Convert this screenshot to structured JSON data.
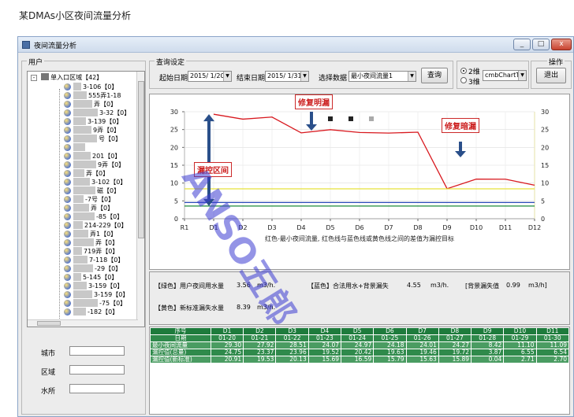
{
  "page_caption": "某DMAs小区夜间流量分析",
  "window": {
    "title": "夜间流量分析",
    "minimize": "_",
    "maximize": "□",
    "close": "x"
  },
  "left_panel": {
    "group_title": "用户",
    "tree_root": "单入口区域【42】",
    "tree_items": [
      "3-106【0】",
      "555弄1-18",
      "弄【0】",
      "3-32【0】",
      "3-139【0】",
      "9弄【0】",
      "号【0】",
      "",
      "201【0】",
      "9弄【0】",
      "弄【0】",
      "3-102【0】",
      "磁【0】",
      "-7号【0】",
      "弄【0】",
      "-85【0】",
      "214-229【0】",
      "弄1【0】",
      "弄【0】",
      "719弄【0】",
      "7-118【0】",
      "-29【0】",
      "5-145【0】",
      "3-159【0】",
      "3-159【0】",
      "-75【0】",
      "-182【0】"
    ],
    "city_label": "城市",
    "district_label": "区域",
    "water_label": "水所"
  },
  "query": {
    "group_title": "查询设定",
    "start_label": "起始日期",
    "start_value": "2015/ 1/20",
    "end_label": "结束日期",
    "end_value": "2015/ 1/31",
    "data_label": "选择数据",
    "data_value": "最小夜间流量1",
    "query_button": "查询",
    "radio_2d": "2维",
    "radio_3d": "3维",
    "chart_type_value": "cmbChartTy",
    "ops_title": "操作",
    "exit_button": "退出"
  },
  "annotations": {
    "fix_visible": "修复明漏",
    "fix_hidden": "修复暗漏",
    "leak_range": "漏控区间"
  },
  "watermark": "ANSO五郎",
  "chart_data": {
    "type": "line",
    "categories": [
      "R1",
      "D1",
      "D2",
      "D3",
      "D4",
      "D5",
      "D6",
      "D7",
      "D8",
      "D9",
      "D10",
      "D11",
      "D12"
    ],
    "ylim": [
      0,
      30
    ],
    "yticks": [
      0,
      5,
      10,
      15,
      20,
      25,
      30
    ],
    "caption": "红色-最小夜间流量, 红色线与蓝色线或黄色线之间的差值为漏控目标",
    "series": [
      {
        "color": "#d8181e",
        "values": [
          null,
          29.3,
          27.92,
          28.51,
          24.07,
          24.97,
          24.18,
          24.01,
          24.27,
          8.42,
          11.1,
          11.09,
          9.4
        ]
      },
      {
        "color": "#1b8a3a",
        "values": [
          3.56,
          3.56,
          3.56,
          3.56,
          3.56,
          3.56,
          3.56,
          3.56,
          3.56,
          3.56,
          3.56,
          3.56,
          3.56
        ]
      },
      {
        "color": "#2a49b8",
        "values": [
          4.55,
          4.55,
          4.55,
          4.55,
          4.55,
          4.55,
          4.55,
          4.55,
          4.55,
          4.55,
          4.55,
          4.55,
          4.55
        ]
      },
      {
        "color": "#e8e23a",
        "values": [
          8.39,
          8.39,
          8.39,
          8.39,
          8.39,
          8.39,
          8.39,
          8.39,
          8.39,
          8.39,
          8.39,
          8.39,
          8.39
        ]
      }
    ]
  },
  "stats": {
    "green_label": "【绿色】用户夜间用水量",
    "green_value": "3.56",
    "green_unit": "m3/h.",
    "blue_label": "【蓝色】合法用水+背景漏失",
    "blue_value": "4.55",
    "blue_unit": "m3/h.",
    "bg_label": "[背景漏失值",
    "bg_value": "0.99",
    "bg_unit": "m3/h]",
    "yellow_label": "【黄色】新标准漏失水量",
    "yellow_value": "8.39",
    "yellow_unit": "m3/h."
  },
  "grid": {
    "header": [
      "序号",
      "D1",
      "D2",
      "D3",
      "D4",
      "D5",
      "D6",
      "D7",
      "D8",
      "D9",
      "D10",
      "D11"
    ],
    "rows": [
      [
        "日期",
        "01-20",
        "01-21",
        "01-22",
        "01-23",
        "01-24",
        "01-25",
        "01-26",
        "01-27",
        "01-28",
        "01-29",
        "01-30"
      ],
      [
        "最小夜间流量",
        "29.30",
        "27.92",
        "28.51",
        "24.07",
        "24.97",
        "24.18",
        "24.01",
        "24.27",
        "8.42",
        "11.10",
        "11.09"
      ],
      [
        "漏控值(总量)",
        "24.75",
        "23.37",
        "23.96",
        "19.52",
        "20.42",
        "19.63",
        "19.46",
        "19.72",
        "3.87",
        "6.55",
        "6.54"
      ],
      [
        "漏控值(新标准)",
        "20.91",
        "19.53",
        "20.13",
        "15.69",
        "16.59",
        "15.79",
        "15.63",
        "15.89",
        "0.04",
        "2.71",
        "2.70"
      ]
    ]
  }
}
